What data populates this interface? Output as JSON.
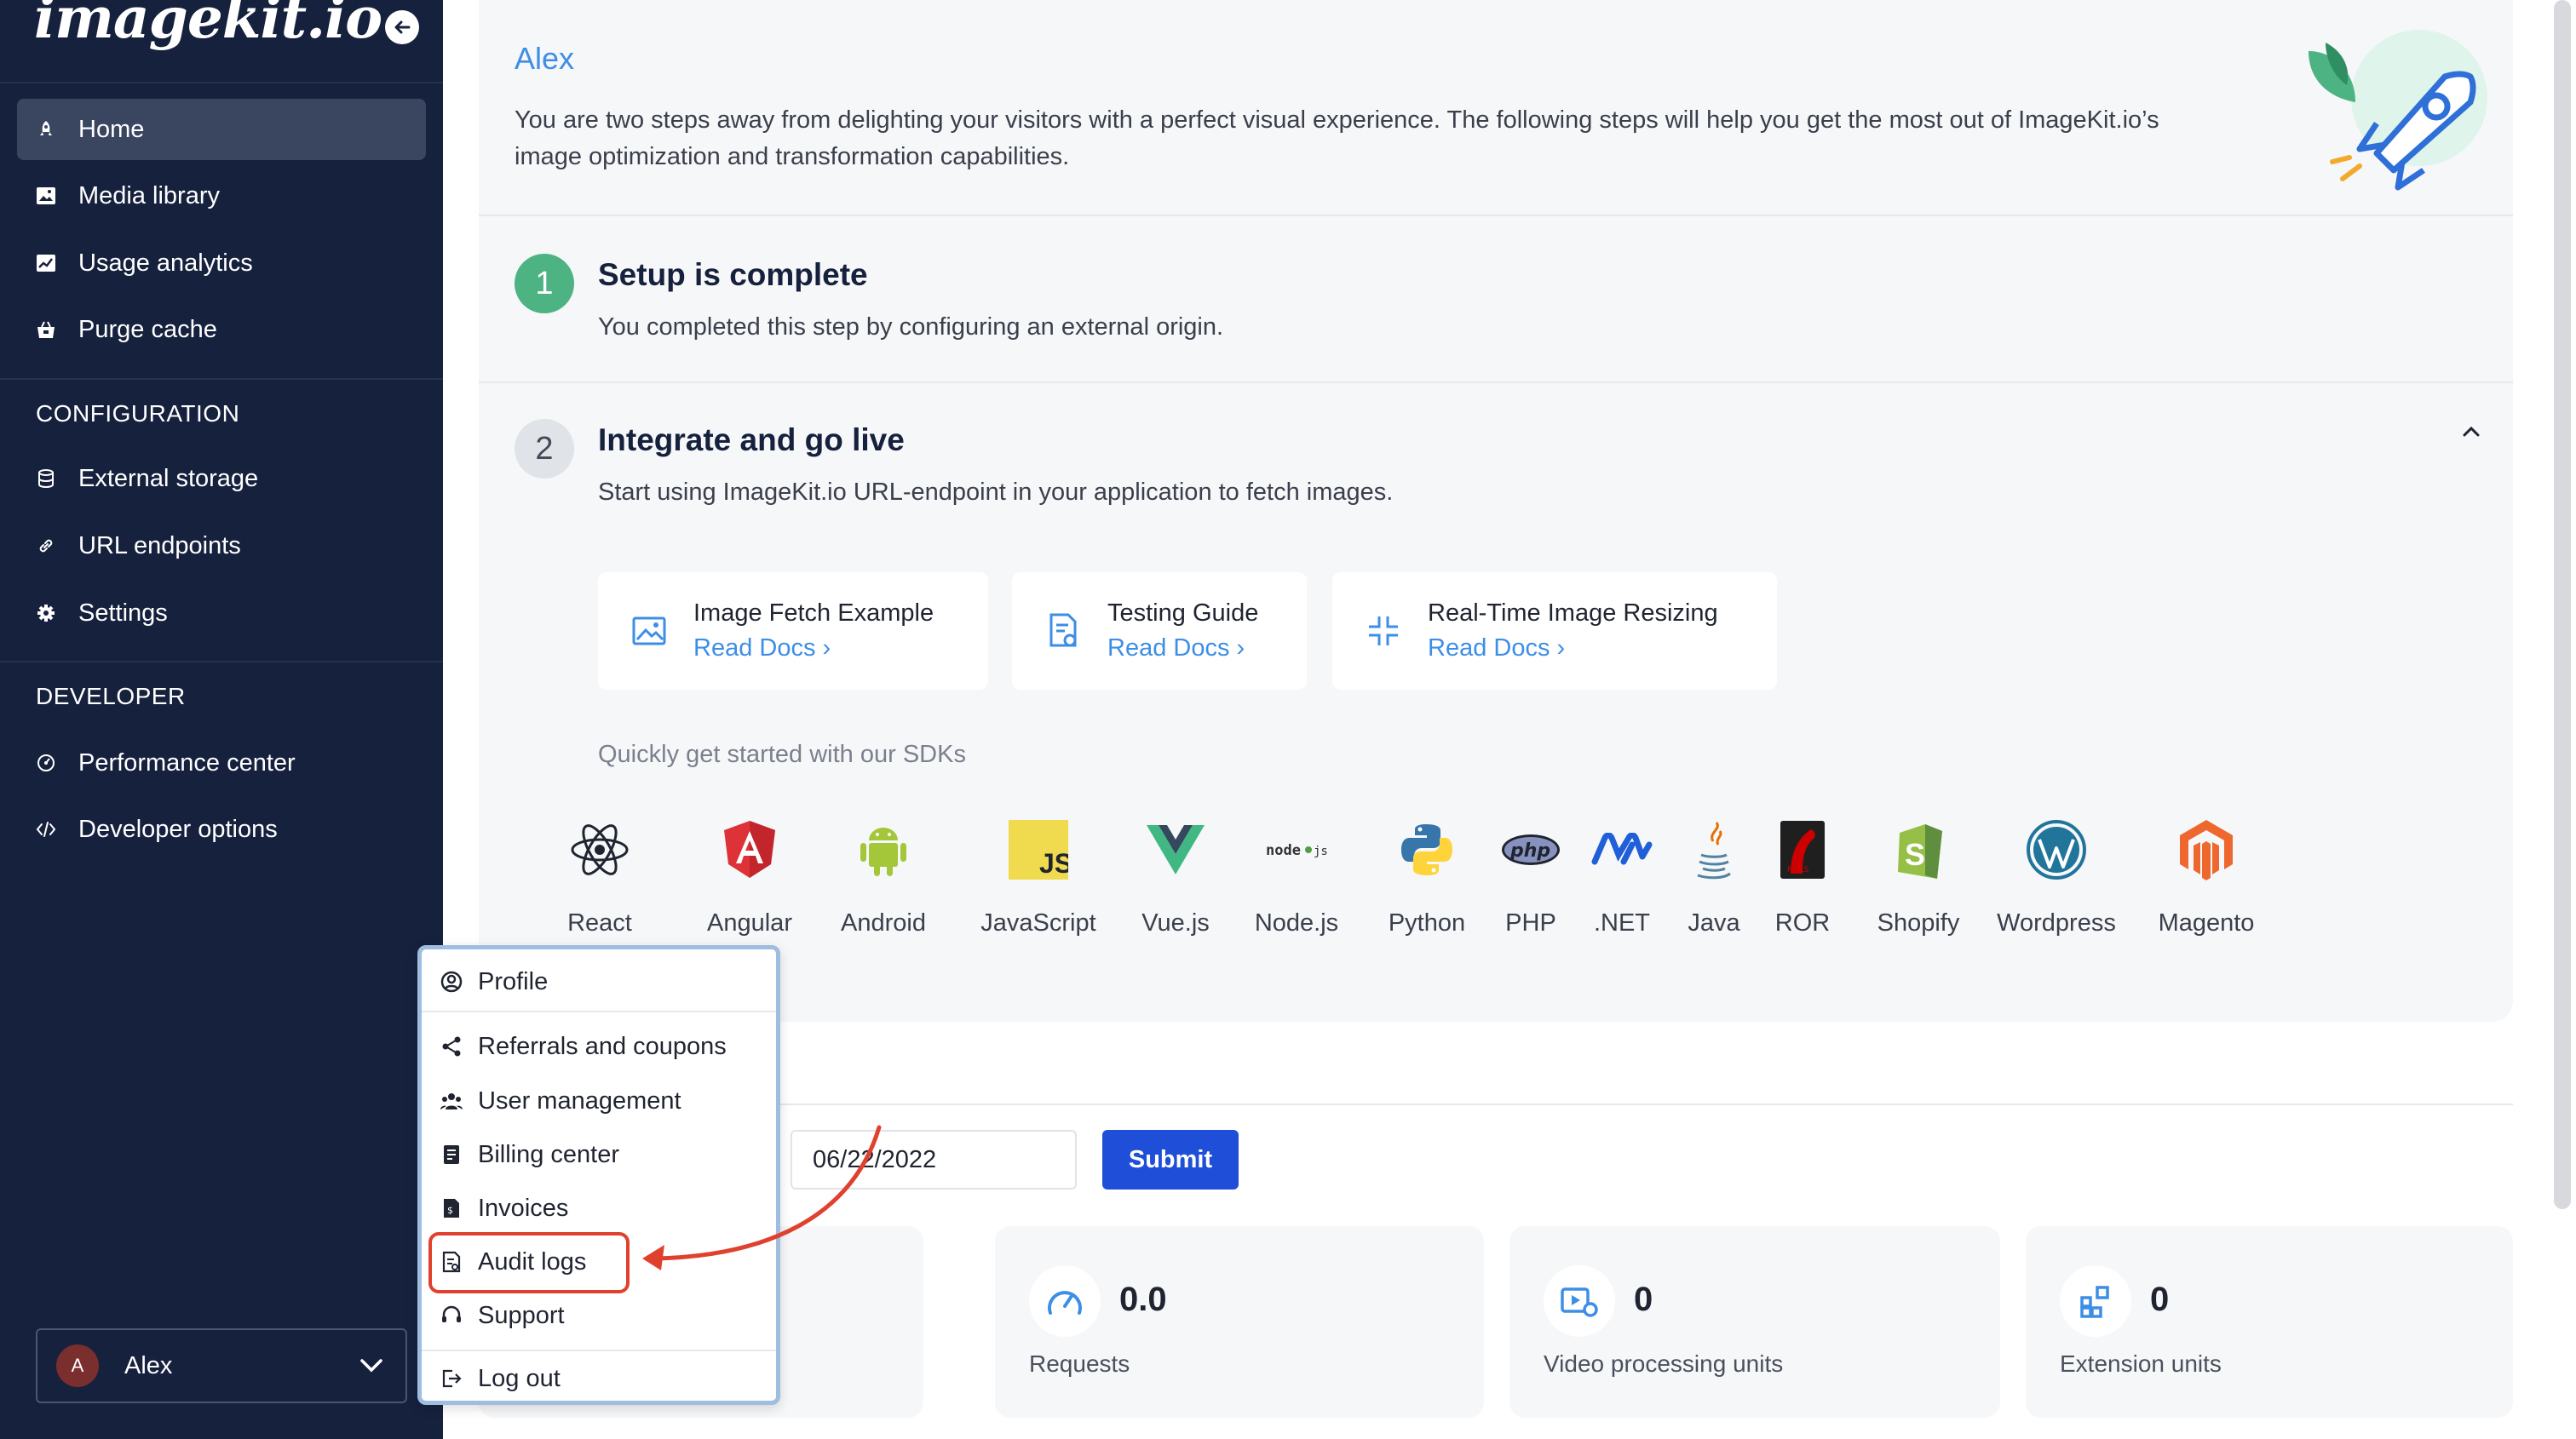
{
  "sidebar": {
    "logo": "imagekit.io",
    "nav": [
      {
        "label": "Home",
        "icon": "rocket-icon"
      },
      {
        "label": "Media library",
        "icon": "image-icon"
      },
      {
        "label": "Usage analytics",
        "icon": "chart-icon"
      },
      {
        "label": "Purge cache",
        "icon": "basket-icon"
      }
    ],
    "configuration": {
      "heading": "CONFIGURATION",
      "items": [
        {
          "label": "External storage",
          "icon": "database-icon"
        },
        {
          "label": "URL endpoints",
          "icon": "link-icon"
        },
        {
          "label": "Settings",
          "icon": "gear-icon"
        }
      ]
    },
    "developer": {
      "heading": "DEVELOPER",
      "items": [
        {
          "label": "Performance center",
          "icon": "gauge-icon"
        },
        {
          "label": "Developer options",
          "icon": "code-icon"
        }
      ]
    },
    "user": {
      "initial": "A",
      "name": "Alex"
    }
  },
  "welcome": {
    "name": "Alex",
    "text": "You are two steps away from delighting your visitors with a perfect visual experience. The following steps will help you get the most out of ImageKit.io’s image optimization and transformation capabilities."
  },
  "steps": [
    {
      "number": "1",
      "title": "Setup is complete",
      "description": "You completed this step by configuring an external origin."
    },
    {
      "number": "2",
      "title": "Integrate and go live",
      "description": "Start using ImageKit.io URL-endpoint in your application to fetch images."
    }
  ],
  "docs": [
    {
      "title": "Image Fetch Example",
      "link": "Read Docs ›"
    },
    {
      "title": "Testing Guide",
      "link": "Read Docs ›"
    },
    {
      "title": "Real-Time Image Resizing",
      "link": "Read Docs ›"
    }
  ],
  "sdk_heading": "Quickly get started with our SDKs",
  "sdks": [
    "React",
    "Angular",
    "Android",
    "JavaScript",
    "Vue.js",
    "Node.js",
    "Python",
    "PHP",
    ".NET",
    "Java",
    "ROR",
    "Shopify",
    "Wordpress",
    "Magento"
  ],
  "date_filter": {
    "value": "06/22/2022",
    "submit": "Submit"
  },
  "stats": [
    {
      "value": "0.0",
      "label": "Requests"
    },
    {
      "value": "0",
      "label": "Video processing units"
    },
    {
      "value": "0",
      "label": "Extension units"
    }
  ],
  "user_menu": {
    "items": [
      "Profile",
      "Referrals and coupons",
      "User management",
      "Billing center",
      "Invoices",
      "Audit logs",
      "Support",
      "Log out"
    ],
    "highlighted": "Audit logs"
  },
  "colors": {
    "sidebar": "#16213e",
    "accent_blue": "#3d8ee6",
    "submit": "#1f4fd8",
    "step_done": "#4db383",
    "annotation": "#e0412e"
  }
}
